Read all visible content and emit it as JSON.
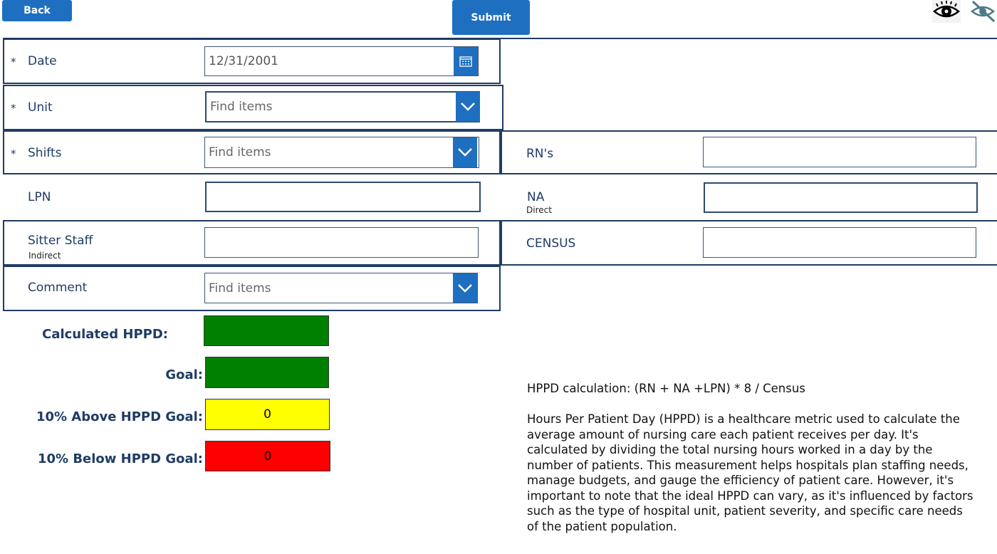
{
  "toolbar": {
    "back_label": "Back",
    "submit_label": "Submit"
  },
  "icons": {
    "show": "eye-icon",
    "hide": "eye-slash-icon"
  },
  "form": {
    "date": {
      "label": "Date",
      "required": "*",
      "value": "12/31/2001"
    },
    "unit": {
      "label": "Unit",
      "required": "*",
      "placeholder": "Find items"
    },
    "shifts": {
      "label": "Shifts",
      "required": "*",
      "placeholder": "Find items"
    },
    "lpn": {
      "label": "LPN",
      "value": ""
    },
    "sitter": {
      "label": "Sitter Staff",
      "sublabel": "Indirect",
      "value": ""
    },
    "comment": {
      "label": "Comment",
      "placeholder": "Find items"
    },
    "rns": {
      "label": "RN's",
      "value": ""
    },
    "na": {
      "label": "NA",
      "sublabel": "Direct",
      "value": ""
    },
    "census": {
      "label": "CENSUS",
      "value": ""
    }
  },
  "metrics": {
    "calculated": {
      "label": "Calculated HPPD:",
      "value": "",
      "color": "#008000"
    },
    "goal": {
      "label": "Goal:",
      "value": "",
      "color": "#008000"
    },
    "above": {
      "label": "10% Above HPPD Goal:",
      "value": "0",
      "color": "#ffff00"
    },
    "below": {
      "label": "10% Below HPPD Goal:",
      "value": "0",
      "color": "#ff0000"
    }
  },
  "info": {
    "formula": "HPPD calculation: (RN + NA +LPN) * 8 / Census",
    "description": "Hours Per Patient Day (HPPD) is a healthcare metric used to calculate the average amount of nursing care each patient receives per day. It's calculated by dividing the total nursing hours worked in a day by the number of patients. This measurement helps hospitals plan staffing needs, manage budgets, and gauge the efficiency of patient care. However, it's important to note that the ideal HPPD can vary, as it's influenced by factors such as the type of hospital unit, patient severity, and specific care needs of the patient population."
  },
  "colors": {
    "accent": "#1e6fc0",
    "border": "#1f3c64",
    "label": "#1f3c64"
  }
}
